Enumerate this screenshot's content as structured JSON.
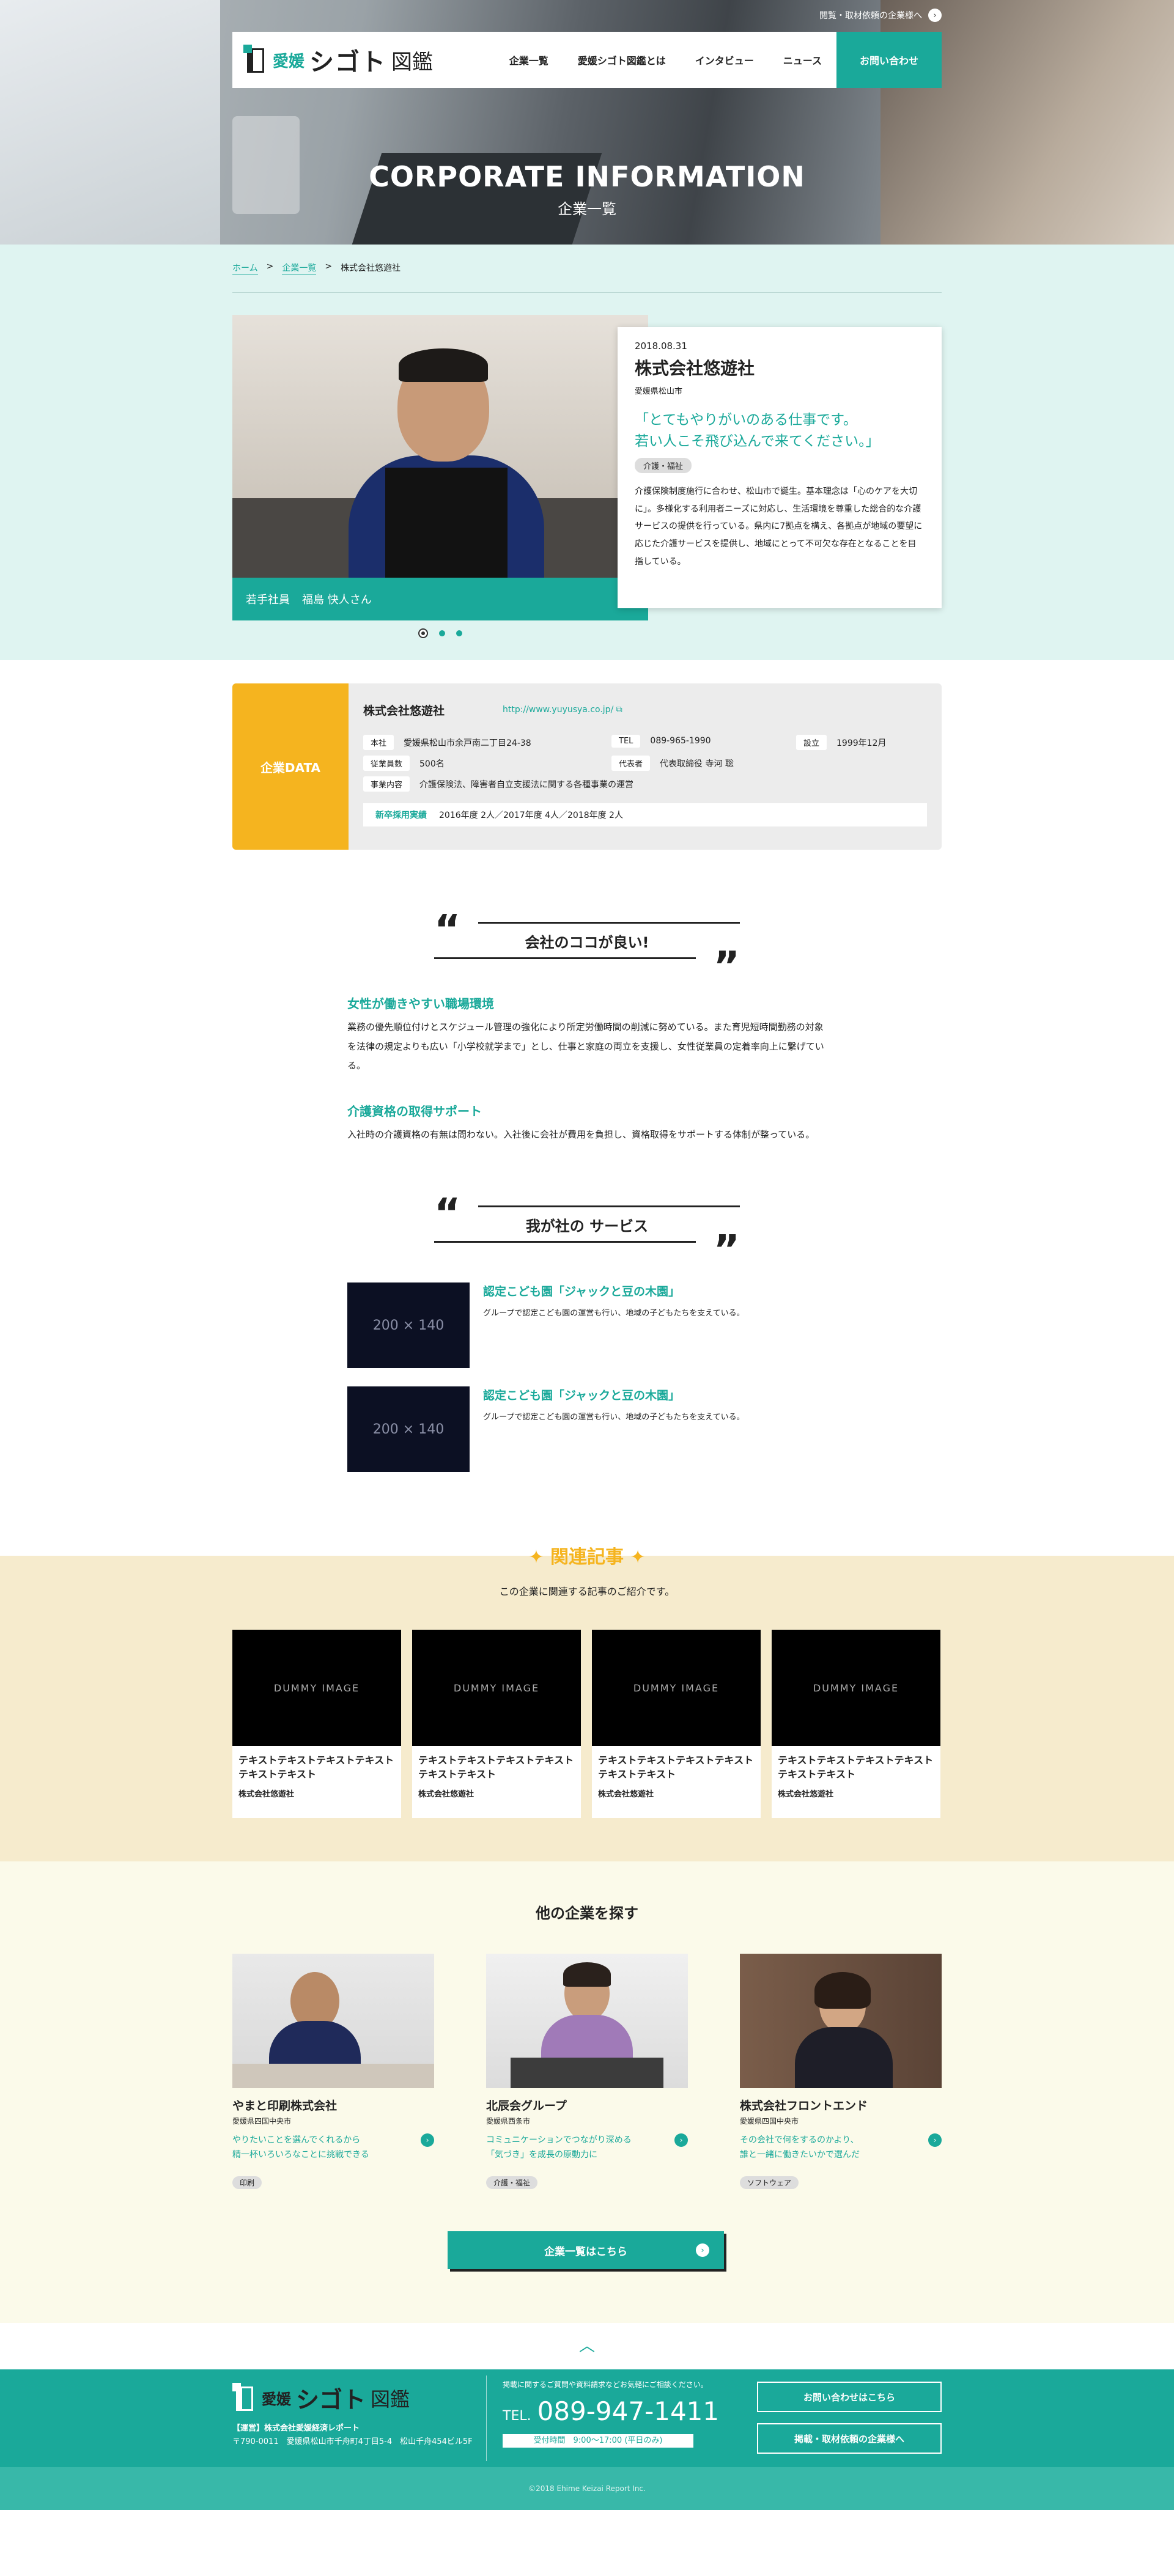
{
  "topbar": {
    "ad_link": "閲覧・取材依頼の企業様へ",
    "ad_icon": "arrow-right-icon"
  },
  "nav": {
    "logo": {
      "ehime": "愛媛",
      "shigoto": "シゴト",
      "zukan": "図鑑"
    },
    "items": [
      "企業一覧",
      "愛媛シゴト図鑑とは",
      "インタビュー",
      "ニュース"
    ],
    "cta": "お問い合わせ"
  },
  "hero": {
    "title": "CORPORATE INFORMATION",
    "subtitle": "企業一覧"
  },
  "breadcrumb": {
    "home": "ホーム",
    "sep": ">",
    "list": "企業一覧",
    "current": "株式会社悠遊社"
  },
  "profile": {
    "caption_role": "若手社員",
    "caption_name": "福島 快人さん",
    "date": "2018.08.31",
    "company": "株式会社悠遊社",
    "area": "愛媛県松山市",
    "catch_line1": "「とてもやりがいのある仕事です。",
    "catch_line2": "若い人こそ飛び込んで来てください。」",
    "tag": "介護・福祉",
    "description": "介護保険制度施行に合わせ、松山市で誕生。基本理念は「心のケアを大切に」。多様化する利用者ニーズに対応し、生活環境を尊重した総合的な介護サービスの提供を行っている。県内に7拠点を構え、各拠点が地域の要望に応じた介護サービスを提供し、地域にとって不可欠な存在となることを目指している。"
  },
  "corp_data": {
    "label": "企業DATA",
    "name": "株式会社悠遊社",
    "url": "http://www.yuyusya.co.jp/",
    "rows": {
      "address_k": "本社",
      "address_v": "愛媛県松山市余戸南二丁目24-38",
      "tel_k": "TEL",
      "tel_v": "089-965-1990",
      "est_k": "設立",
      "est_v": "1999年12月",
      "emp_k": "従業員数",
      "emp_v": "500名",
      "rep_k": "代表者",
      "rep_v": "代表取締役 寺河 聡",
      "biz_k": "事業内容",
      "biz_v": "介護保険法、障害者自立支援法に関する各種事業の運営"
    },
    "hire_k": "新卒採用実績",
    "hire_v": "2016年度 2人／2017年度 4人／2018年度 2人"
  },
  "good_points": {
    "title": "会社のココが良い!",
    "items": [
      {
        "h": "女性が働きやすい職場環境",
        "b": "業務の優先順位付けとスケジュール管理の強化により所定労働時間の削減に努めている。また育児短時間勤務の対象を法律の規定よりも広い「小学校就学まで」とし、仕事と家庭の両立を支援し、女性従業員の定着率向上に繋げている。"
      },
      {
        "h": "介護資格の取得サポート",
        "b": "入社時の介護資格の有無は問わない。入社後に会社が費用を負担し、資格取得をサポートする体制が整っている。"
      }
    ]
  },
  "services": {
    "title": "我が社の サービス",
    "items": [
      {
        "img": "200 × 140",
        "t": "認定こども園「ジャックと豆の木園」",
        "d": "グループで認定こども園の運営も行い、地域の子どもたちを支えている。"
      },
      {
        "img": "200 × 140",
        "t": "認定こども園「ジャックと豆の木園」",
        "d": "グループで認定こども園の運営も行い、地域の子どもたちを支えている。"
      }
    ]
  },
  "related": {
    "title": "関連記事",
    "subtitle": "この企業に関連する記事のご紹介です。",
    "cards": [
      {
        "img": "DUMMY IMAGE",
        "title": "テキストテキストテキストテキストテキストテキスト",
        "company": "株式会社悠遊社"
      },
      {
        "img": "DUMMY IMAGE",
        "title": "テキストテキストテキストテキストテキストテキスト",
        "company": "株式会社悠遊社"
      },
      {
        "img": "DUMMY IMAGE",
        "title": "テキストテキストテキストテキストテキストテキスト",
        "company": "株式会社悠遊社"
      },
      {
        "img": "DUMMY IMAGE",
        "title": "テキストテキストテキストテキストテキストテキスト",
        "company": "株式会社悠遊社"
      }
    ]
  },
  "others": {
    "title": "他の企業を探す",
    "cards": [
      {
        "name": "やまと印刷株式会社",
        "area": "愛媛県四国中央市",
        "c1": "やりたいことを選んでくれるから",
        "c2": "精一杯いろいろなことに挑戦できる",
        "tag": "印刷"
      },
      {
        "name": "北辰会グループ",
        "area": "愛媛県西条市",
        "c1": "コミュニケーションでつながり深める",
        "c2": "「気づき」を成長の原動力に",
        "tag": "介護・福祉"
      },
      {
        "name": "株式会社フロントエンド",
        "area": "愛媛県四国中央市",
        "c1": "その会社で何をするのかより、",
        "c2": "誰と一緒に働きたいかで選んだ",
        "tag": "ソフトウェア"
      }
    ],
    "list_button": "企業一覧はこちら"
  },
  "footer": {
    "logo": {
      "ehime": "愛媛",
      "shigoto": "シゴト",
      "zukan": "図鑑"
    },
    "operator": "【運営】株式会社愛媛経済レポート",
    "address": "〒790-0011　愛媛県松山市千舟町4丁目5-4　松山千舟454ビル5F",
    "note": "掲載に関するご質問や資料請求などお気軽にご相談ください。",
    "tel_label": "TEL.",
    "tel": "089-947-1411",
    "hours": "受付時間　9:00〜17:00 (平日のみ)",
    "btn_contact": "お問い合わせはこちら",
    "btn_ad": "掲載・取材依頼の企業様へ",
    "copyright": "©2018 Ehime Keizai Report Inc."
  }
}
